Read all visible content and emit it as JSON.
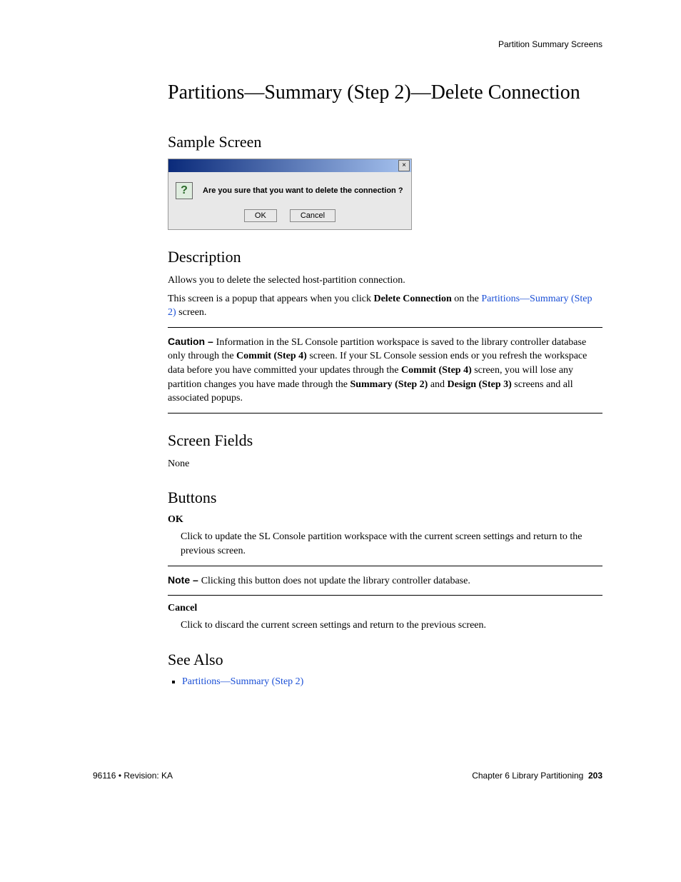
{
  "running_head": "Partition Summary Screens",
  "title": "Partitions—Summary (Step 2)—Delete Connection",
  "sample": {
    "heading": "Sample Screen",
    "dialog_message": "Are you sure that you want to delete the connection ?",
    "ok_label": "OK",
    "cancel_label": "Cancel",
    "question_mark": "?",
    "close_glyph": "×"
  },
  "description": {
    "heading": "Description",
    "p1": "Allows you to delete the selected host-partition connection.",
    "p2_a": "This screen is a popup that appears when you click ",
    "p2_bold": "Delete Connection",
    "p2_b": " on the ",
    "p2_link": "Partitions—Summary (Step 2)",
    "p2_c": " screen.",
    "caution_label": "Caution – ",
    "caution_a": "Information in the SL Console partition workspace is saved to the library controller database only through the ",
    "caution_b1": "Commit (Step 4)",
    "caution_c": " screen. If your SL Console session ends or you refresh the workspace data before you have committed your updates through the ",
    "caution_b2": "Commit (Step 4)",
    "caution_d": " screen, you will lose any partition changes you have made through the ",
    "caution_b3": "Summary (Step 2)",
    "caution_e": " and ",
    "caution_b4": "Design (Step 3)",
    "caution_f": " screens and all associated popups."
  },
  "screen_fields": {
    "heading": "Screen Fields",
    "body": "None"
  },
  "buttons": {
    "heading": "Buttons",
    "ok_name": "OK",
    "ok_desc": "Click to update the SL Console partition workspace with the current screen settings and return to the previous screen.",
    "note_label": "Note – ",
    "note_body": "Clicking this button does not update the library controller database.",
    "cancel_name": "Cancel",
    "cancel_desc": "Click to discard the current screen settings and return to the previous screen."
  },
  "see_also": {
    "heading": "See Also",
    "link": "Partitions—Summary (Step 2)"
  },
  "footer": {
    "left": "96116 • Revision: KA",
    "right_text": "Chapter 6 Library Partitioning",
    "page": "203"
  }
}
